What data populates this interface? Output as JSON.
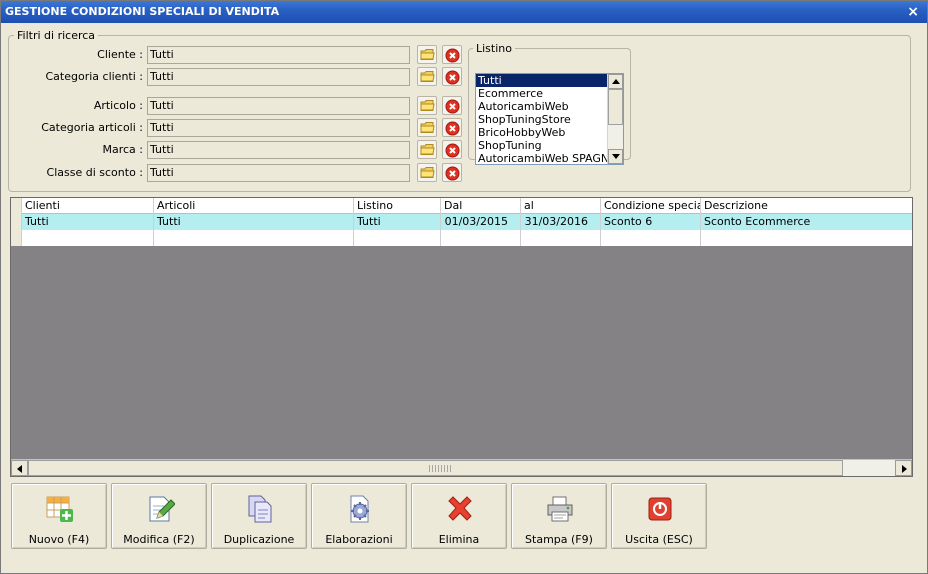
{
  "window": {
    "title": "GESTIONE CONDIZIONI SPECIALI DI VENDITA",
    "close_glyph": "×"
  },
  "filters": {
    "legend": "Filtri di ricerca",
    "rows": [
      {
        "label": "Cliente :",
        "value": "Tutti"
      },
      {
        "label": "Categoria clienti :",
        "value": "Tutti"
      },
      {
        "label": "Articolo :",
        "value": "Tutti"
      },
      {
        "label": "Categoria articoli :",
        "value": "Tutti"
      },
      {
        "label": "Marca :",
        "value": "Tutti"
      },
      {
        "label": "Classe di sconto :",
        "value": "Tutti"
      }
    ]
  },
  "listino": {
    "legend": "Listino",
    "items": [
      "Tutti",
      "Ecommerce",
      "AutoricambiWeb",
      "ShopTuningStore",
      "BricoHobbyWeb",
      "ShopTuning",
      "AutoricambiWeb SPAGNA"
    ],
    "selected_index": 0
  },
  "grid": {
    "columns": [
      "Clienti",
      "Articoli",
      "Listino",
      "Dal",
      "al",
      "Condizione speciale",
      "Descrizione"
    ],
    "rows": [
      [
        "Tutti",
        "Tutti",
        "Tutti",
        "01/03/2015",
        "31/03/2016",
        "Sconto 6",
        "Sconto Ecommerce"
      ],
      [
        "",
        "",
        "",
        "",
        "",
        "",
        ""
      ]
    ]
  },
  "buttons": {
    "nuovo": "Nuovo (F4)",
    "modifica": "Modifica (F2)",
    "duplicazione": "Duplicazione",
    "elaborazioni": "Elaborazioni",
    "elimina": "Elimina",
    "stampa": "Stampa (F9)",
    "uscita": "Uscita (ESC)"
  },
  "colors": {
    "titlebar": "#2a60c4",
    "selected_row": "#b4eef0",
    "list_selection": "#0a246a",
    "grid_background": "#848284"
  }
}
